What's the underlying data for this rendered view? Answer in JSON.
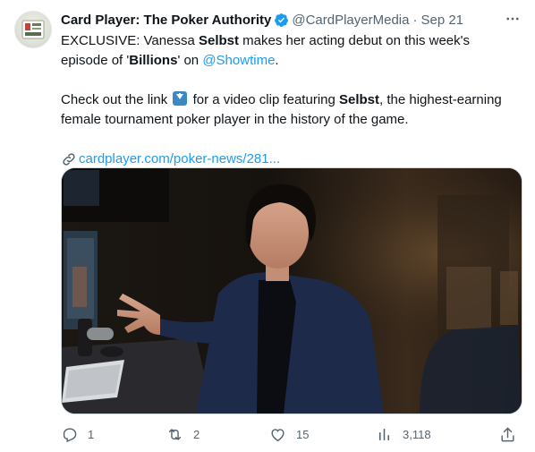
{
  "author": {
    "name": "Card Player: The Poker Authority",
    "handle": "@CardPlayerMedia",
    "separator": "·",
    "timestamp": "Sep 21"
  },
  "icons": {
    "verified": "verified-badge-icon",
    "more": "more-options-icon",
    "link": "link-icon",
    "reply": "reply-icon",
    "retweet": "retweet-icon",
    "like": "like-icon",
    "views": "views-icon",
    "share": "share-icon"
  },
  "colors": {
    "accent": "#1d9bf0",
    "text": "#0f1419",
    "muted": "#536471"
  },
  "tweet": {
    "l1_a": "EXCLUSIVE: Vanessa ",
    "l1_b": "Selbst",
    "l1_c": " makes her acting debut on this week's",
    "l2_a": "episode of '",
    "l2_b": "Billions",
    "l2_c": "' on ",
    "l2_mention": "@Showtime",
    "l2_d": ".",
    "l3_a": "Check out the link ",
    "l3_b": " for a video clip featuring ",
    "l3_c": "Selbst",
    "l3_d": ", the highest-earning",
    "l4": "female tournament poker player in the history of the game.",
    "link_text": "cardplayer.com/poker-news/281..."
  },
  "stats": {
    "replies": "1",
    "retweets": "2",
    "likes": "15",
    "views": "3,118"
  }
}
